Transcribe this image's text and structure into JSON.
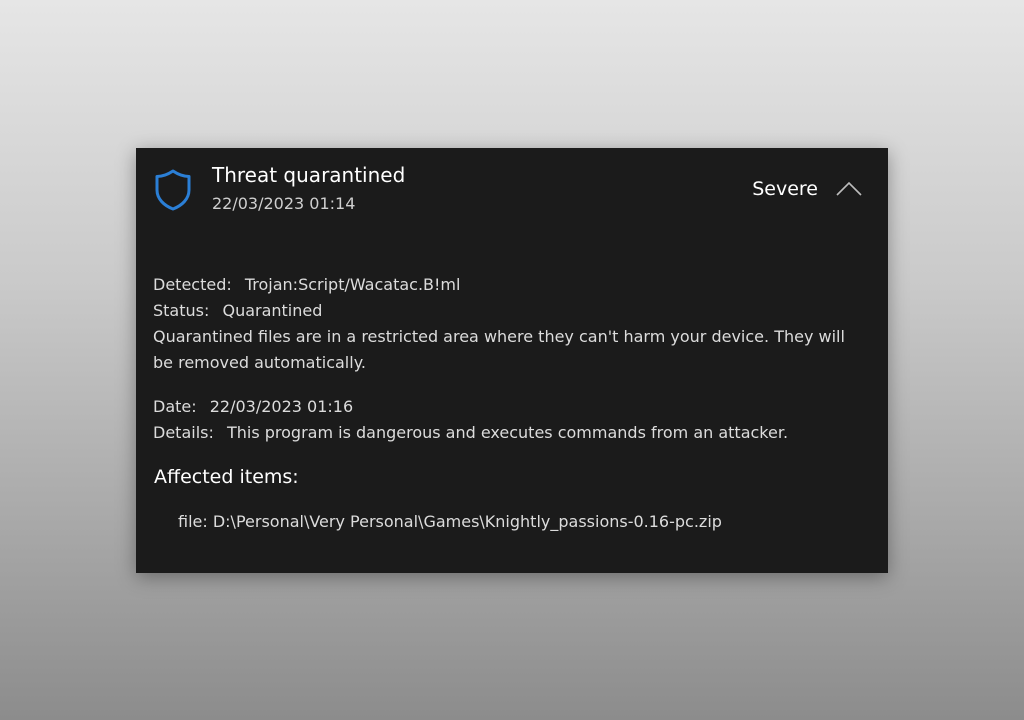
{
  "notification": {
    "title": "Threat quarantined",
    "timestamp": "22/03/2023 01:14",
    "severity": "Severe",
    "accent_color": "#2b7fd6"
  },
  "details": {
    "detected_label": "Detected:",
    "detected_value": "Trojan:Script/Wacatac.B!ml",
    "status_label": "Status:",
    "status_value": "Quarantined",
    "status_description": "Quarantined files are in a restricted area where they can't harm your device. They will be removed automatically.",
    "date_label": "Date:",
    "date_value": "22/03/2023 01:16",
    "details_label": "Details:",
    "details_value": "This program is dangerous and executes commands from an attacker."
  },
  "affected": {
    "heading": "Affected items:",
    "items": [
      "file: D:\\Personal\\Very Personal\\Games\\Knightly_passions-0.16-pc.zip"
    ]
  },
  "icons": {
    "shield": "shield-icon",
    "collapse": "chevron-up-icon"
  }
}
